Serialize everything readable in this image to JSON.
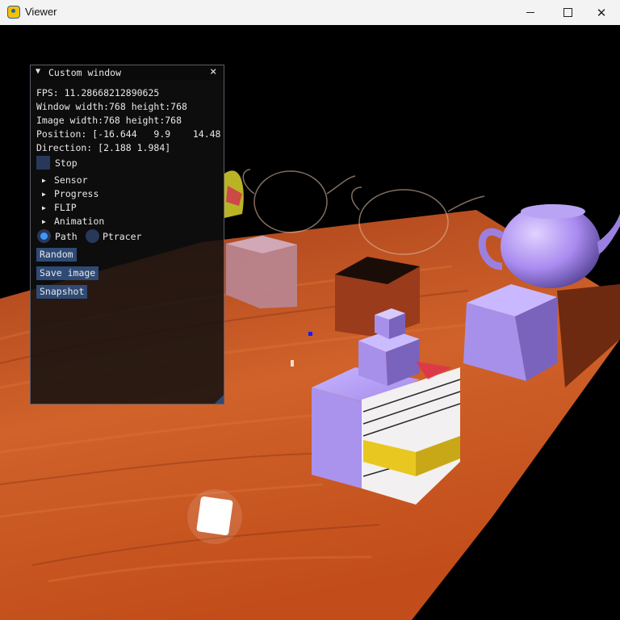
{
  "window": {
    "title": "Viewer",
    "app_icon": "python-icon",
    "controls": [
      "minimize-icon",
      "maximize-icon",
      "close-icon"
    ]
  },
  "panel": {
    "title": "Custom window",
    "collapse_icon": "▼",
    "close_icon": "×",
    "stats": {
      "fps": "FPS: 11.28668212890625",
      "window_size": "Window width:768 height:768",
      "image_size": "Image width:768 height:768",
      "position": "Position: [-16.644   9.9    14.48",
      "direction": "Direction: [2.188 1.984]"
    },
    "stop_label": "Stop",
    "stop_checked": false,
    "sections": [
      "Sensor",
      "Progress",
      "FLIP",
      "Animation"
    ],
    "tree_arrow": "▶",
    "modes": [
      "Path",
      "Ptracer"
    ],
    "selected_mode": "Path",
    "buttons": {
      "random": "Random",
      "save_image": "Save image",
      "snapshot": "Snapshot"
    }
  },
  "colors": {
    "panel_bg": "#0f0f0f",
    "button": "#2e4a75",
    "radio_active": "#4296fa",
    "table_wood": "#c8521e",
    "purple_material": "#a98af0"
  }
}
